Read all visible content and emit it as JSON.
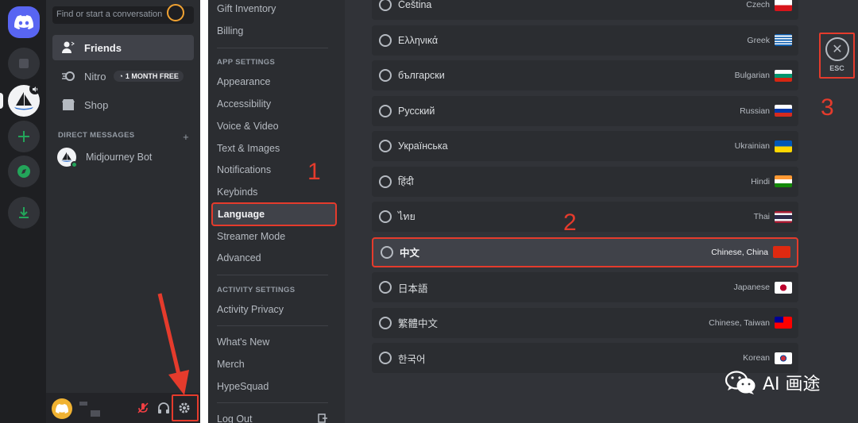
{
  "rail": {
    "icons": [
      "discord-logo-icon",
      "server-icon",
      "midjourney-server-icon",
      "add-server-icon",
      "explore-icon",
      "download-icon"
    ]
  },
  "dm_sidebar": {
    "search_placeholder": "Find or start a conversation",
    "items": [
      {
        "label": "Friends",
        "icon": "friends-icon"
      },
      {
        "label": "Nitro",
        "icon": "nitro-icon",
        "badge": "1 MONTH FREE"
      },
      {
        "label": "Shop",
        "icon": "shop-icon"
      }
    ],
    "direct_messages_header": "DIRECT MESSAGES",
    "add_dm": "+",
    "dms": [
      {
        "name": "Midjourney Bot",
        "status": "online"
      }
    ]
  },
  "settings_nav": {
    "top_items": [
      "Gift Inventory",
      "Billing"
    ],
    "app_settings_header": "APP SETTINGS",
    "app_items": [
      "Appearance",
      "Accessibility",
      "Voice & Video",
      "Text & Images",
      "Notifications",
      "Keybinds",
      "Language",
      "Streamer Mode",
      "Advanced"
    ],
    "active_item": "Language",
    "activity_header": "ACTIVITY SETTINGS",
    "activity_items": [
      "Activity Privacy"
    ],
    "misc_items": [
      "What's New",
      "Merch",
      "HypeSquad"
    ],
    "logout": "Log Out"
  },
  "languages": [
    {
      "native": "Čeština",
      "english": "Czech",
      "flag": "cz"
    },
    {
      "native": "Ελληνικά",
      "english": "Greek",
      "flag": "gr"
    },
    {
      "native": "български",
      "english": "Bulgarian",
      "flag": "bg"
    },
    {
      "native": "Русский",
      "english": "Russian",
      "flag": "ru"
    },
    {
      "native": "Українська",
      "english": "Ukrainian",
      "flag": "ua"
    },
    {
      "native": "हिंदी",
      "english": "Hindi",
      "flag": "in"
    },
    {
      "native": "ไทย",
      "english": "Thai",
      "flag": "th"
    },
    {
      "native": "中文",
      "english": "Chinese, China",
      "flag": "cn",
      "selected": true
    },
    {
      "native": "日本語",
      "english": "Japanese",
      "flag": "jp"
    },
    {
      "native": "繁體中文",
      "english": "Chinese, Taiwan",
      "flag": "tw"
    },
    {
      "native": "한국어",
      "english": "Korean",
      "flag": "kr"
    }
  ],
  "close": {
    "label": "ESC",
    "icon": "close-icon"
  },
  "annotations": {
    "step1": "1",
    "step2": "2",
    "step3": "3",
    "accent": "#e53b2c"
  },
  "watermark": {
    "text": "AI 画途",
    "icon": "wechat-icon"
  }
}
